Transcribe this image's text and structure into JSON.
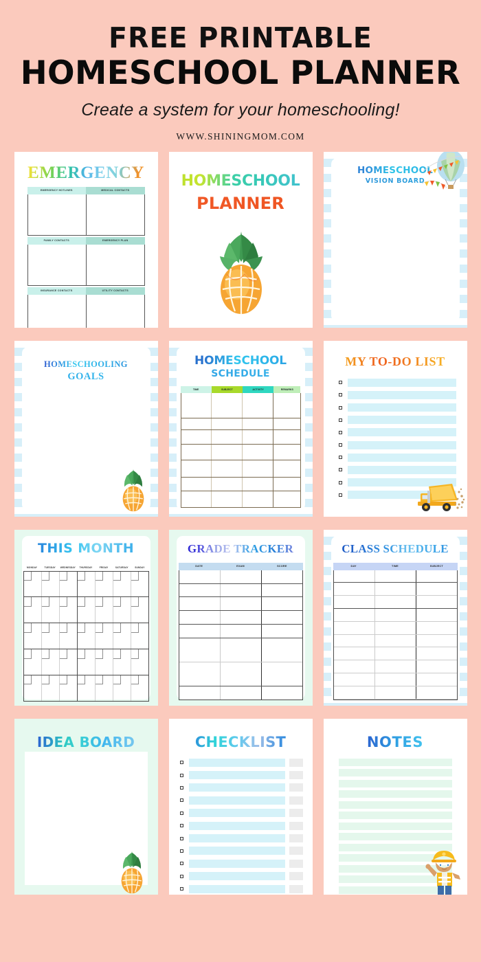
{
  "header": {
    "line1": "FREE PRINTABLE",
    "line2": "HOMESCHOOL PLANNER",
    "subtitle": "Create a system for your homeschooling!",
    "url": "WWW.SHININGMOM.COM"
  },
  "theme": {
    "background": "#fbcabd",
    "page_white": "#ffffff",
    "stripe_blue": "#d7eff9",
    "mint": "#e6f9ef",
    "bar_blue": "#d5f2f9",
    "bar_gray": "#ececec",
    "note_line": "#e4f7ec"
  },
  "pages": [
    {
      "id": "emergency",
      "title": "EMERGENCY",
      "background": "white",
      "table_headers": [
        "EMERGENCY HOTLINES",
        "MEDICAL CONTACTS",
        "FAMILY CONTACTS",
        "EMERGENCY PLAN",
        "INSURANCE CONTACTS",
        "UTILITY CONTACTS"
      ]
    },
    {
      "id": "cover",
      "title_line1": "HOMESCHOOL",
      "title_line2": "PLANNER",
      "background": "white",
      "art": "pineapple-illustration"
    },
    {
      "id": "vision-board",
      "title_line1": "HOMESCHOOL",
      "title_line2": "VISION BOARD",
      "background": "stripe-blue",
      "art": "hot-air-balloon-illustration"
    },
    {
      "id": "goals",
      "title_line1": "HOMESCHOOLING",
      "title_line2": "GOALS",
      "background": "stripe-blue",
      "art": "pineapple-illustration"
    },
    {
      "id": "schedule",
      "title_line1": "HOMESCHOOL",
      "title_line2": "SCHEDULE",
      "background": "stripe-blue",
      "columns": [
        "TIME",
        "SUBJECT",
        "ACTIVITY",
        "REMARKS"
      ],
      "column_colors": [
        "#cdf3e7",
        "#a8d92b",
        "#2fd7c0",
        "#bfeeb8"
      ],
      "rows": 7
    },
    {
      "id": "todo",
      "title": "MY TO-DO LIST",
      "background": "white",
      "rows": 10,
      "art": "dump-truck-illustration"
    },
    {
      "id": "this-month",
      "title": "THIS MONTH",
      "background": "mint",
      "weekdays": [
        "MONDAY",
        "TUESDAY",
        "WEDNESDAY",
        "THURSDAY",
        "FRIDAY",
        "SATURDAY",
        "SUNDAY"
      ],
      "weeks": 5
    },
    {
      "id": "grade-tracker",
      "title": "GRADE TRACKER",
      "background": "mint",
      "columns": [
        "DATE",
        "EXAM",
        "SCORE"
      ],
      "rows": 8
    },
    {
      "id": "class-schedule",
      "title": "CLASS SCHEDULE",
      "background": "stripe-blue",
      "columns": [
        "DAY",
        "TIME",
        "SUBJECT"
      ],
      "rows": 10
    },
    {
      "id": "idea-board",
      "title": "IDEA BOARD",
      "background": "mint",
      "art": "pineapple-illustration"
    },
    {
      "id": "checklist",
      "title": "CHECKLIST",
      "background": "white",
      "rows": 11
    },
    {
      "id": "notes",
      "title": "NOTES",
      "background": "white",
      "lines": 13,
      "art": "boy-construction-worker-illustration"
    }
  ]
}
